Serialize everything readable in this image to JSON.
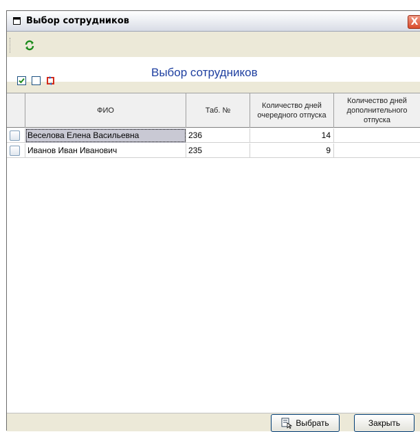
{
  "window": {
    "title": "Выбор сотрудников",
    "close_glyph": "X"
  },
  "toolbar": {
    "refresh_icon": "refresh-icon"
  },
  "form": {
    "title": "Выбор сотрудников",
    "check_all_icon": "checkbox-checked-icon",
    "uncheck_all_icon": "checkbox-empty-icon",
    "invert_icon": "invert-selection-icon"
  },
  "grid": {
    "columns": [
      "ФИО",
      "Таб. №",
      "Количество дней очередного отпуска",
      "Количество дней дополнительного отпуска"
    ],
    "rows": [
      {
        "checked": false,
        "fio": "Веселова Елена Васильевна",
        "tab_no": "236",
        "regular_days": "14",
        "extra_days": ""
      },
      {
        "checked": false,
        "fio": "Иванов Иван Иванович",
        "tab_no": "235",
        "regular_days": "9",
        "extra_days": ""
      }
    ]
  },
  "buttons": {
    "select_label": "Выбрать",
    "close_label": "Закрыть"
  }
}
